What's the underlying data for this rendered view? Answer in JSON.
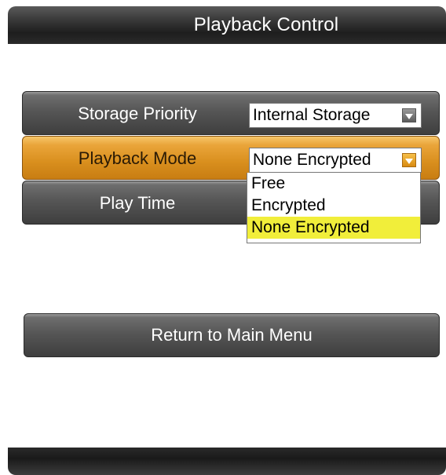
{
  "header": {
    "title": "Playback Control"
  },
  "menu": {
    "storage_priority": {
      "label": "Storage Priority",
      "value": "Internal Storage",
      "arrow_icon": "chevron-down-icon"
    },
    "playback_mode": {
      "label": "Playback Mode",
      "value": "None Encrypted",
      "arrow_icon": "chevron-down-icon",
      "highlighted": true,
      "options": [
        "Free",
        "Encrypted",
        "None Encrypted"
      ],
      "selected_option": "None Encrypted"
    },
    "play_time": {
      "label": "Play Time"
    }
  },
  "actions": {
    "return_label": "Return to Main Menu"
  },
  "colors": {
    "highlight_row": "#e29a2c",
    "selected_option": "#f1ee3a",
    "bar_dark": "#1e1e1e"
  }
}
